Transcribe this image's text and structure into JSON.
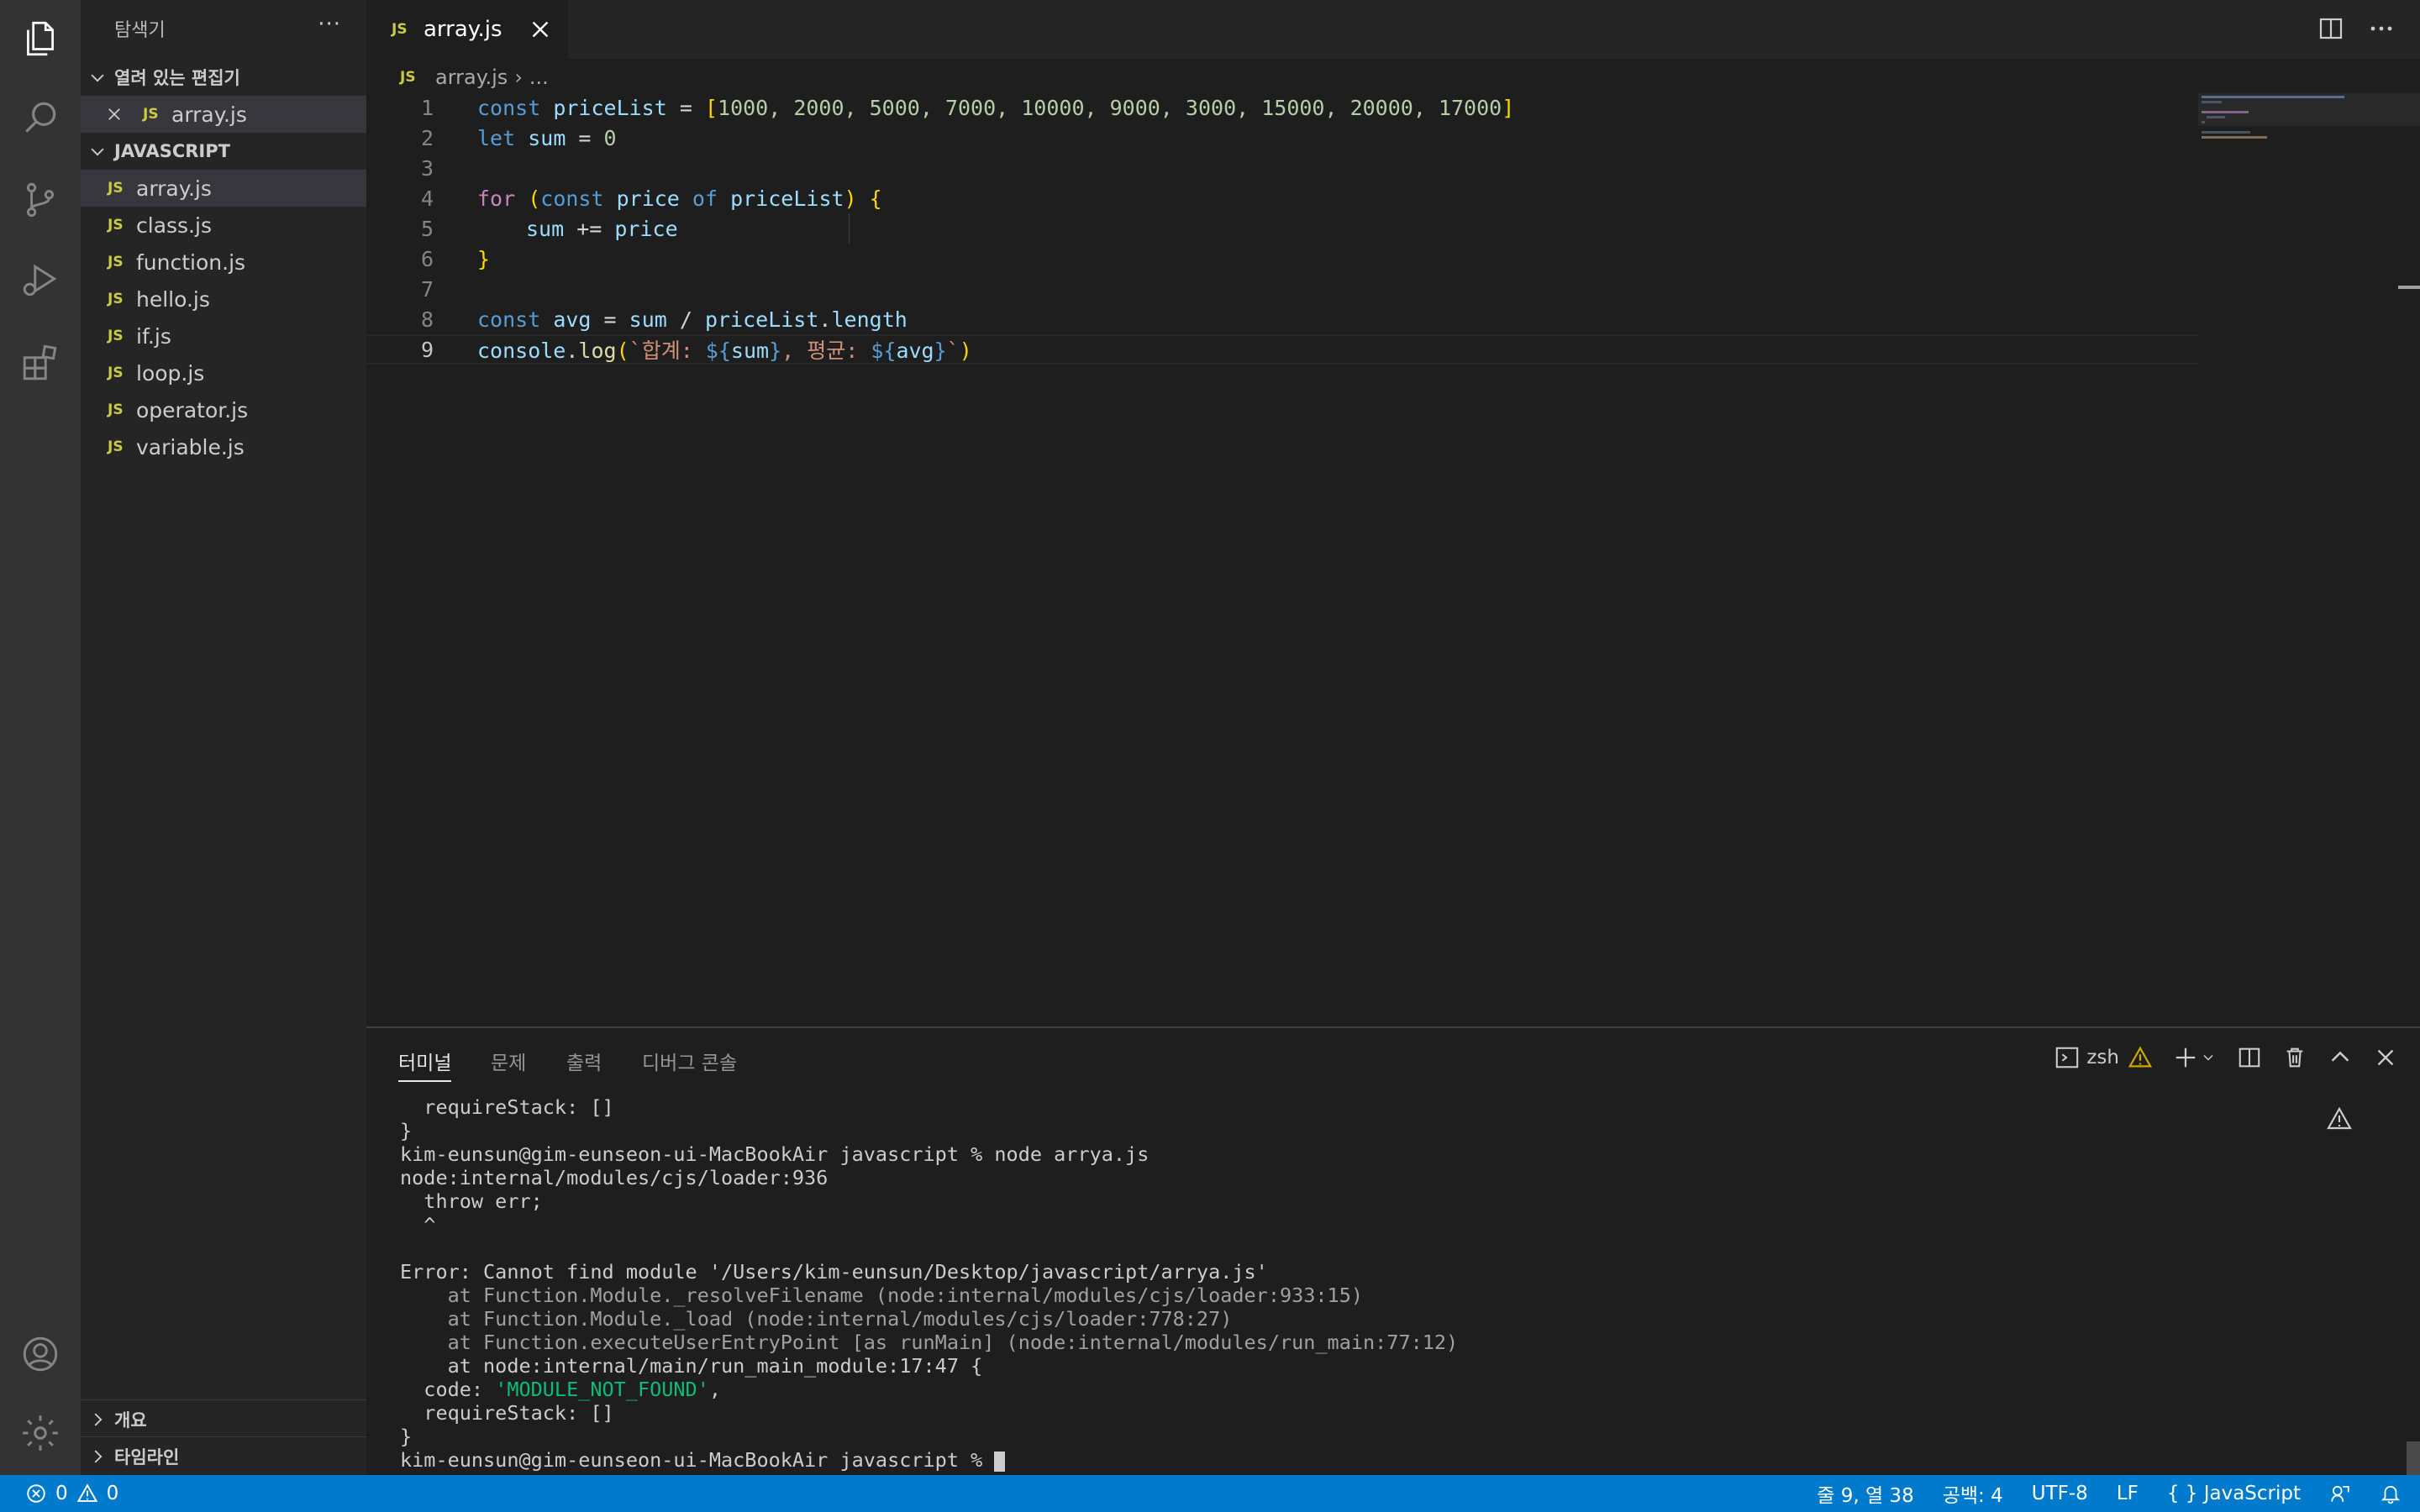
{
  "sidebar": {
    "title": "탐색기",
    "more": "···",
    "open_editors": {
      "label": "열려 있는 편집기",
      "items": [
        "array.js"
      ]
    },
    "folder": {
      "label": "JAVASCRIPT",
      "files": [
        "array.js",
        "class.js",
        "function.js",
        "hello.js",
        "if.js",
        "loop.js",
        "operator.js",
        "variable.js"
      ]
    },
    "outline_label": "개요",
    "timeline_label": "타임라인",
    "js_badge": "JS"
  },
  "tab": {
    "label": "array.js",
    "badge": "JS"
  },
  "breadcrumb": {
    "file": "array.js",
    "sep": "›",
    "rest": "..."
  },
  "code": {
    "line_numbers": [
      "1",
      "2",
      "3",
      "4",
      "5",
      "6",
      "7",
      "8",
      "9"
    ],
    "l1": {
      "kw": "const",
      "name": "priceList",
      "op": " = ",
      "open": "[",
      "nums": "1000, 2000, 5000, 7000, 10000, 9000, 3000, 15000, 20000, 17000",
      "close": "]"
    },
    "l2": {
      "kw": "let",
      "name": "sum",
      "op": " = ",
      "num": "0"
    },
    "l4": {
      "kw": "for",
      "open": " (",
      "kw2": "const",
      "v1": "price",
      "of": "of",
      "v2": "priceList",
      "close": ")",
      "brace": " {"
    },
    "l5": {
      "v1": "sum",
      "op": " += ",
      "v2": "price"
    },
    "l6": {
      "brace": "}"
    },
    "l8": {
      "kw": "const",
      "name": "avg",
      "op": " = ",
      "v1": "sum",
      "div": " / ",
      "v2": "priceList",
      "dot": ".",
      "prop": "length"
    },
    "l9": {
      "obj": "console",
      "dot": ".",
      "fn": "log",
      "open": "(",
      "s1": "`합계: ",
      "i1o": "${",
      "i1": "sum",
      "i1c": "}",
      "s2": ", 평균: ",
      "i2o": "${",
      "i2": "avg",
      "i2c": "}",
      "s3": "`",
      "close": ")"
    }
  },
  "panel": {
    "tabs": [
      "터미널",
      "문제",
      "출력",
      "디버그 콘솔"
    ],
    "shell": "zsh",
    "terminal": {
      "l1": "  requireStack: []",
      "l2": "}",
      "l3": "kim-eunsun@gim-eunseon-ui-MacBookAir javascript % node arrya.js",
      "l4": "node:internal/modules/cjs/loader:936",
      "l5": "  throw err;",
      "l6": "  ^",
      "l7": "",
      "l8": "Error: Cannot find module '/Users/kim-eunsun/Desktop/javascript/arrya.js'",
      "l9": "    at Function.Module._resolveFilename (node:internal/modules/cjs/loader:933:15)",
      "l10": "    at Function.Module._load (node:internal/modules/cjs/loader:778:27)",
      "l11": "    at Function.executeUserEntryPoint [as runMain] (node:internal/modules/run_main:77:12)",
      "l12": "    at node:internal/main/run_main_module:17:47 {",
      "l13a": "  code: ",
      "l13b": "'MODULE_NOT_FOUND'",
      "l13c": ",",
      "l14": "  requireStack: []",
      "l15": "}",
      "l16": "kim-eunsun@gim-eunseon-ui-MacBookAir javascript % "
    }
  },
  "status": {
    "errors": "0",
    "warnings": "0",
    "position": "줄 9, 열 38",
    "spaces": "공백: 4",
    "encoding": "UTF-8",
    "eol": "LF",
    "lang_braces": "{ }",
    "language": "JavaScript"
  },
  "colors": {
    "status_bar": "#007acc",
    "js_badge": "#cbcb41",
    "terminal_string": "#0dbc79"
  }
}
